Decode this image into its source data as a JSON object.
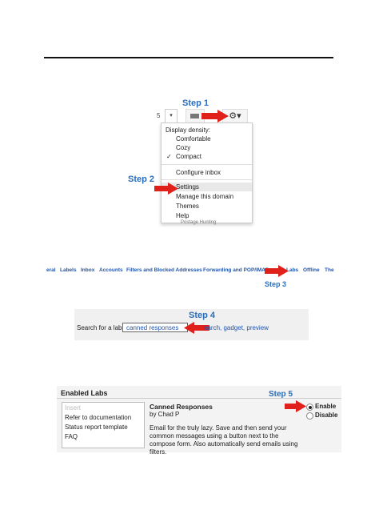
{
  "section1": {
    "step_label": "Step 1",
    "step2_label": "Step 2",
    "toolbar_number": "5",
    "toolbar_caret": "▾",
    "gear_symbol": "⚙▾",
    "menu": {
      "header": "Display density:",
      "items": [
        "Comfortable",
        "Cozy",
        "Compact"
      ],
      "checked": "✓",
      "configure": "Configure inbox",
      "settings": "Settings",
      "manage": "Manage this domain",
      "themes": "Themes",
      "help": "Help"
    },
    "under_text": "Postage Hunting"
  },
  "section2": {
    "tabs": [
      "eral",
      "Labels",
      "Inbox",
      "Accounts",
      "Filters and Blocked Addresses",
      "Forwarding and POP/IMAP",
      "Labs",
      "Offline",
      "The"
    ],
    "step_label": "Step 3"
  },
  "section3": {
    "step_label": "Step 4",
    "search_label": "Search for a lab:",
    "search_value": "canned responses",
    "links": "earch, gadget, preview"
  },
  "section4": {
    "title": "Enabled Labs",
    "list": [
      "Insert",
      "Refer to documentation",
      "Status report template",
      "FAQ"
    ],
    "lab_title": "Canned Responses",
    "lab_by": "by Chad P",
    "lab_desc": "Email for the truly lazy. Save and then send your common messages using a button next to the compose form. Also automatically send emails using filters.",
    "step_label": "Step 5",
    "enable_label": "Enable",
    "disable_label": "Disable",
    "selected": "Enable"
  },
  "colors": {
    "step_blue": "#2a6ebb",
    "arrow_red": "#e0201b",
    "link_blue": "#2255aa"
  }
}
